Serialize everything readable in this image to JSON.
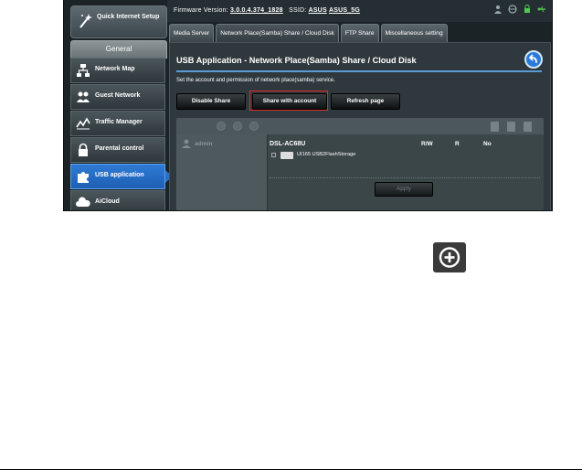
{
  "sidebar": {
    "qis_label": "Quick Internet Setup",
    "general_header": "General",
    "items": [
      {
        "label": "Network Map",
        "icon": "network-map-icon"
      },
      {
        "label": "Guest Network",
        "icon": "guest-network-icon"
      },
      {
        "label": "Traffic Manager",
        "icon": "traffic-manager-icon"
      },
      {
        "label": "Parental control",
        "icon": "lock-icon"
      },
      {
        "label": "USB application",
        "icon": "puzzle-icon",
        "active": true
      },
      {
        "label": "AiCloud",
        "icon": "cloud-icon"
      }
    ]
  },
  "topbar": {
    "firmware_label": "Firmware Version:",
    "firmware_value": "3.0.0.4.374_1828",
    "ssid_label": "SSID:",
    "ssid_1": "ASUS",
    "ssid_2": "ASUS_5G"
  },
  "tabs": [
    {
      "label": "Media Server"
    },
    {
      "label": "Network Place(Samba) Share / Cloud Disk",
      "active": true
    },
    {
      "label": "FTP Share"
    },
    {
      "label": "Miscellaneous setting"
    }
  ],
  "content": {
    "title": "USB Application - Network Place(Samba) Share / Cloud Disk",
    "description": "Set the account and permission of network place(samba) service.",
    "buttons": {
      "disable_share": "Disable Share",
      "share_with_account": "Share with account",
      "refresh_page": "Refresh page"
    },
    "account": "admin",
    "device": "DSL-AC68U",
    "columns": [
      "R/W",
      "R",
      "No"
    ],
    "storage": "UI165 USB2FlashStorage",
    "apply_label": "Apply"
  },
  "colors": {
    "accent_blue": "#2a7ad9",
    "highlight_red": "#e02b2b",
    "panel_dark": "#1c2326"
  }
}
